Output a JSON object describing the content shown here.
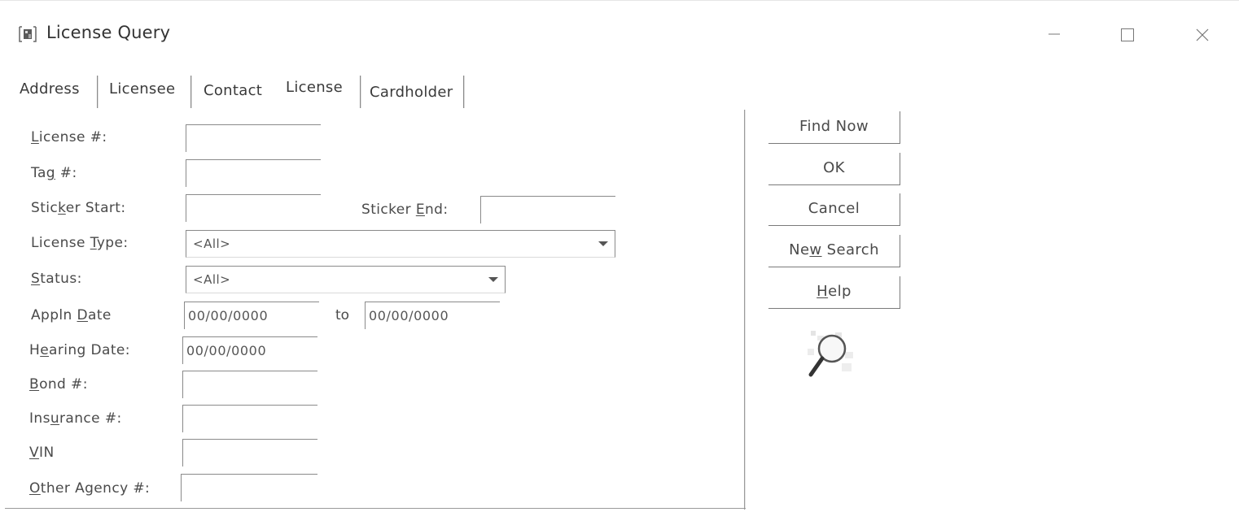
{
  "window": {
    "title": "License Query",
    "icon": "app-icon",
    "controls": [
      "minimize-icon",
      "maximize-icon",
      "close-icon"
    ]
  },
  "tabs": [
    {
      "label": "Address"
    },
    {
      "label": "Licensee"
    },
    {
      "label": "Contact"
    },
    {
      "label": "License",
      "selected": true
    },
    {
      "label": "Cardholder"
    }
  ],
  "form": {
    "license_no": {
      "label": "License #:",
      "value": ""
    },
    "tag_no": {
      "label": "Tag #:",
      "value": ""
    },
    "sticker_start": {
      "label": "Sticker Start:",
      "value": ""
    },
    "sticker_end": {
      "label": "Sticker End:",
      "value": ""
    },
    "license_type": {
      "label": "License Type:",
      "value": "<All>"
    },
    "status": {
      "label": "Status:",
      "value": "<All>"
    },
    "appln_date": {
      "label": "Appln Date",
      "from": "00/00/0000",
      "to_label": "to",
      "to": "00/00/0000"
    },
    "hearing_date": {
      "label": "Hearing Date:",
      "value": "00/00/0000"
    },
    "bond_no": {
      "label": "Bond #:",
      "value": ""
    },
    "insurance_no": {
      "label": "Insurance #:",
      "value": ""
    },
    "vin": {
      "label": "VIN",
      "value": ""
    },
    "other_agency_no": {
      "label": "Other Agency #:",
      "value": ""
    }
  },
  "buttons": {
    "find_now": "Find Now",
    "ok": "OK",
    "cancel": "Cancel",
    "new_search": "New Search",
    "help": "Help"
  },
  "colors": {
    "background": "#ffffff",
    "text": "#4a4a4a",
    "border": "#8a8a8a"
  }
}
